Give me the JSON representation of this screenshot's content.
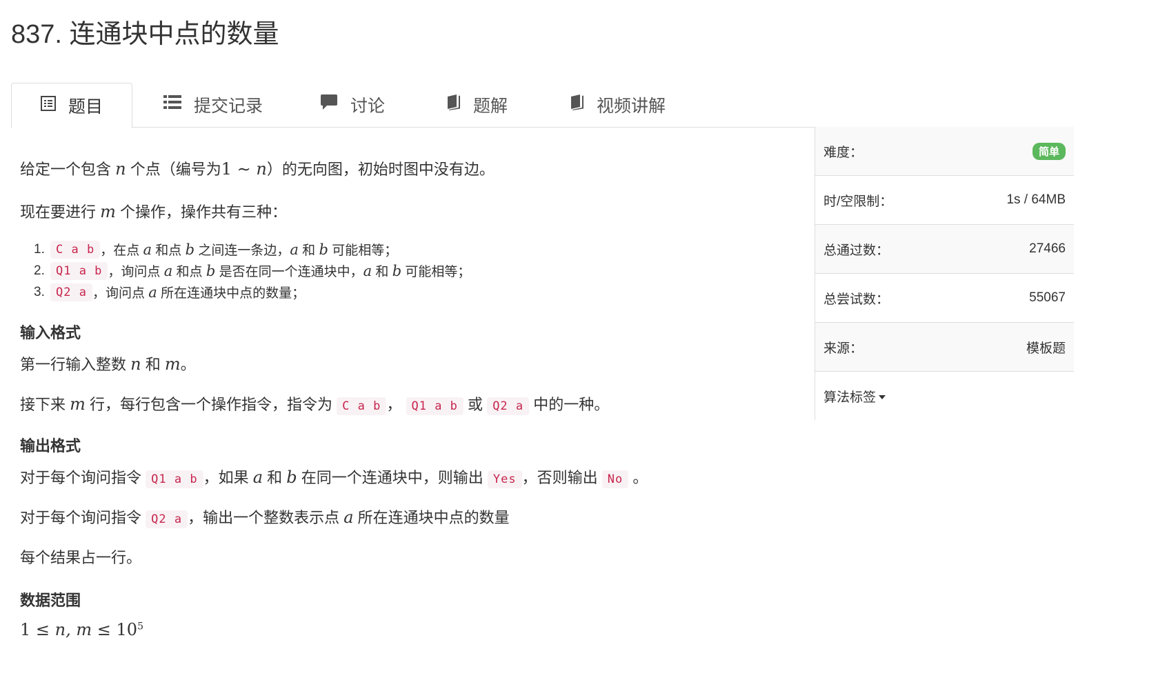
{
  "page": {
    "title": "837. 连通块中点的数量"
  },
  "tabs": [
    {
      "label": "题目",
      "icon": "list-alt-icon"
    },
    {
      "label": "提交记录",
      "icon": "list-icon"
    },
    {
      "label": "讨论",
      "icon": "comment-icon"
    },
    {
      "label": "题解",
      "icon": "book-icon"
    },
    {
      "label": "视频讲解",
      "icon": "book-icon"
    }
  ],
  "problem": {
    "p1": {
      "a": "给定一个包含",
      "n": "n",
      "b": "个点（编号为",
      "range": "1 ∼ ",
      "n2": "n",
      "c": "）的无向图，初始时图中没有边。"
    },
    "p2": {
      "a": "现在要进行",
      "m": "m",
      "b": "个操作，操作共有三种："
    },
    "ops": [
      {
        "num": "1.",
        "code": "C a b",
        "t1": "，在点",
        "v1": "a",
        "t2": "和点",
        "v2": "b",
        "t3": "之间连一条边，",
        "v3": "a",
        "t4": "和",
        "v4": "b",
        "t5": "可能相等；"
      },
      {
        "num": "2.",
        "code": "Q1 a b",
        "t1": "，询问点",
        "v1": "a",
        "t2": "和点",
        "v2": "b",
        "t3": "是否在同一个连通块中，",
        "v3": "a",
        "t4": "和",
        "v4": "b",
        "t5": "可能相等；"
      },
      {
        "num": "3.",
        "code": "Q2 a",
        "t1": "，询问点",
        "v1": "a",
        "t2": "所在连通块中点的数量；"
      }
    ],
    "input_heading": "输入格式",
    "input_p1": {
      "a": "第一行输入整数",
      "n": "n",
      "b": "和",
      "m": "m",
      "c": "。"
    },
    "input_p2": {
      "a": "接下来",
      "m": "m",
      "b": "行，每行包含一个操作指令，指令为",
      "c1": "C a b",
      "sep1": "，",
      "c2": "Q1 a b",
      "sep2": "或",
      "c3": "Q2 a",
      "c": "中的一种。"
    },
    "output_heading": "输出格式",
    "output_p1": {
      "a": "对于每个询问指令",
      "c1": "Q1 a b",
      "b": "，如果",
      "v1": "a",
      "d": "和",
      "v2": "b",
      "e": "在同一个连通块中，则输出",
      "c2": "Yes",
      "f": "，否则输出",
      "c3": "No",
      "g": "。"
    },
    "output_p2": {
      "a": "对于每个询问指令",
      "c1": "Q2 a",
      "b": "，输出一个整数表示点",
      "v1": "a",
      "c": "所在连通块中点的数量"
    },
    "output_p3": "每个结果占一行。",
    "range_heading": "数据范围",
    "range": {
      "one": "1",
      "le1": " ≤ ",
      "vars": "n, m",
      "le2": " ≤ ",
      "base": "10",
      "exp": "5"
    }
  },
  "sidebar": {
    "difficulty_label": "难度：",
    "difficulty_value": "简单",
    "limit_label": "时/空限制：",
    "limit_value": "1s / 64MB",
    "passed_label": "总通过数：",
    "passed_value": "27466",
    "tried_label": "总尝试数：",
    "tried_value": "55067",
    "source_label": "来源：",
    "source_value": "模板题",
    "tags_label": "算法标签"
  }
}
